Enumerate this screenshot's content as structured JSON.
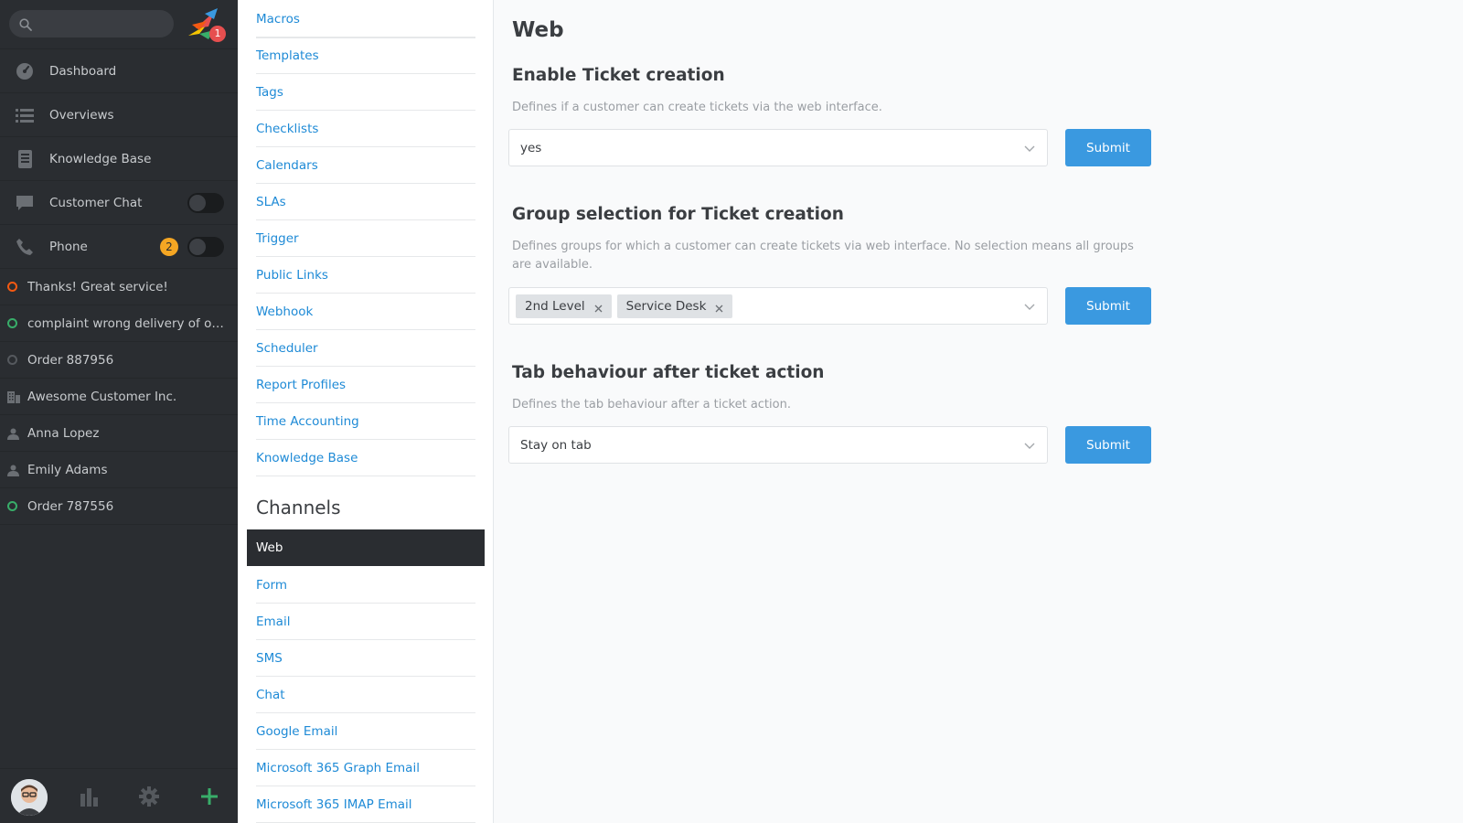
{
  "sidebar": {
    "search_placeholder": "",
    "notification_count": "1",
    "nav": [
      {
        "label": "Dashboard",
        "icon": "dashboard-icon"
      },
      {
        "label": "Overviews",
        "icon": "overviews-icon"
      },
      {
        "label": "Knowledge Base",
        "icon": "knowledge-base-icon"
      },
      {
        "label": "Customer Chat",
        "icon": "chat-icon"
      },
      {
        "label": "Phone",
        "icon": "phone-icon",
        "badge": "2"
      }
    ],
    "tasks": [
      {
        "label": "Thanks! Great service!",
        "icon": "ticket-open-icon",
        "color": "#f35912"
      },
      {
        "label": "complaint wrong delivery of ord...",
        "icon": "ticket-new-icon",
        "color": "#38ad69"
      },
      {
        "label": "Order 887956",
        "icon": "ticket-closed-icon",
        "color": "#6b6f74"
      },
      {
        "label": "Awesome Customer Inc.",
        "icon": "organization-icon",
        "color": "#6b6f74"
      },
      {
        "label": "Anna Lopez",
        "icon": "user-icon",
        "color": "#6b6f74"
      },
      {
        "label": "Emily Adams",
        "icon": "user-icon",
        "color": "#6b6f74"
      },
      {
        "label": "Order 787556",
        "icon": "ticket-new-icon",
        "color": "#38ad69"
      }
    ]
  },
  "admin_nav": {
    "items": [
      "Macros",
      "Templates",
      "Tags",
      "Checklists",
      "Calendars",
      "SLAs",
      "Trigger",
      "Public Links",
      "Webhook",
      "Scheduler",
      "Report Profiles",
      "Time Accounting",
      "Knowledge Base"
    ],
    "channels_title": "Channels",
    "channels": [
      "Web",
      "Form",
      "Email",
      "SMS",
      "Chat",
      "Google Email",
      "Microsoft 365 Graph Email",
      "Microsoft 365 IMAP Email"
    ],
    "active": "Web"
  },
  "main": {
    "title": "Web",
    "settings": [
      {
        "title": "Enable Ticket creation",
        "description": "Defines if a customer can create tickets via the web interface.",
        "value": "yes",
        "submit": "Submit"
      },
      {
        "title": "Group selection for Ticket creation",
        "description": "Defines groups for which a customer can create tickets via web interface. No selection means all groups are available.",
        "tokens": [
          "2nd Level",
          "Service Desk"
        ],
        "submit": "Submit"
      },
      {
        "title": "Tab behaviour after ticket action",
        "description": "Defines the tab behaviour after a ticket action.",
        "value": "Stay on tab",
        "submit": "Submit"
      }
    ]
  },
  "colors": {
    "accent": "#3a99e0",
    "link": "#1e8ad6",
    "sidebar_bg": "#2a2d31",
    "badge_red": "#e64f4f",
    "badge_orange": "#f5a623"
  }
}
